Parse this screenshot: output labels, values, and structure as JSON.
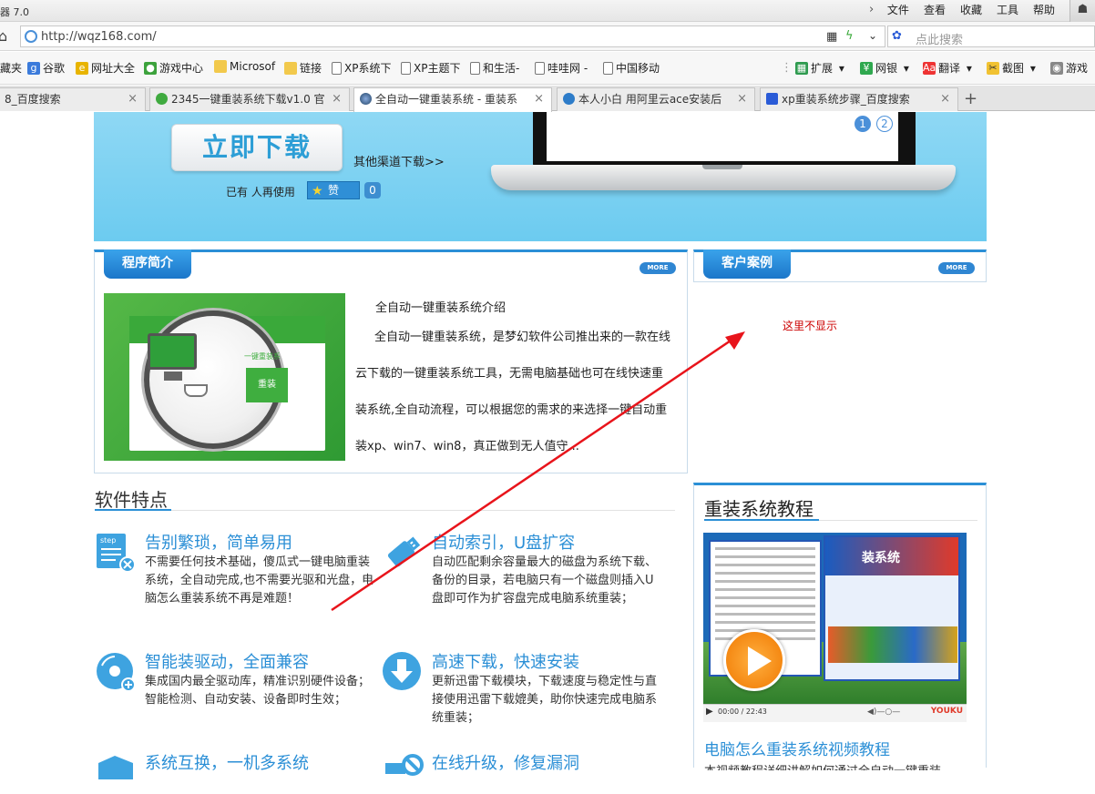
{
  "browser": {
    "app_title": "器 7.0",
    "menu": [
      "文件",
      "查看",
      "收藏",
      "工具",
      "帮助"
    ],
    "url": "http://wqz168.com/",
    "search_placeholder": "点此搜索",
    "favorites": [
      {
        "label": "藏夹",
        "icon": "none"
      },
      {
        "label": "谷歌",
        "icon": "google-icon"
      },
      {
        "label": "网址大全",
        "icon": "globe-icon"
      },
      {
        "label": "游戏中心",
        "icon": "game-icon"
      },
      {
        "label": "Microsof",
        "icon": "folder-icon"
      },
      {
        "label": "链接",
        "icon": "folder-icon"
      },
      {
        "label": "XP系统下",
        "icon": "doc-icon"
      },
      {
        "label": "XP主题下",
        "icon": "doc-icon"
      },
      {
        "label": "和生活-",
        "icon": "doc-icon"
      },
      {
        "label": "哇哇网 -",
        "icon": "doc-icon"
      },
      {
        "label": "中国移动",
        "icon": "doc-icon"
      }
    ],
    "tools": [
      {
        "label": "扩展",
        "icon": "extension-icon"
      },
      {
        "label": "网银",
        "icon": "bank-icon"
      },
      {
        "label": "翻译",
        "icon": "translate-icon"
      },
      {
        "label": "截图",
        "icon": "screenshot-icon"
      },
      {
        "label": "游戏",
        "icon": "game-icon"
      }
    ],
    "tabs": [
      {
        "label": "8_百度搜索",
        "active": false
      },
      {
        "label": "2345一键重装系统下载v1.0 官",
        "active": false
      },
      {
        "label": "全自动一键重装系统 - 重装系",
        "active": true
      },
      {
        "label": "本人小白 用阿里云ace安装后",
        "active": false
      },
      {
        "label": "xp重装系统步骤_百度搜索",
        "active": false
      }
    ]
  },
  "banner": {
    "download_label": "立即下载",
    "other_download": "其他渠道下载>>",
    "users_text": "已有 人再使用",
    "like_label": "赞",
    "like_count": "0",
    "slide_dots": [
      "1",
      "2"
    ]
  },
  "intro": {
    "tab_label": "程序简介",
    "more_label": "MORE",
    "image_text": "一键重装系",
    "image_button": "重装",
    "title": "全自动一键重装系统介绍",
    "text": "全自动一键重装系统，是梦幻软件公司推出来的一款在线云下载的一键重装系统工具，无需电脑基础也可在线快速重装系统,全自动流程，可以根据您的需求的来选择一键自动重装xp、win7、win8，真正做到无人值守..."
  },
  "cases": {
    "tab_label": "客户案例",
    "more_label": "MORE",
    "annotation": "这里不显示"
  },
  "features": {
    "title": "软件特点",
    "items": [
      {
        "title": "告别繁琐，简单易用",
        "desc": "不需要任何技术基础，傻瓜式一键电脑重装系统，全自动完成,也不需要光驱和光盘，电脑怎么重装系统不再是难题！",
        "icon": "step-icon"
      },
      {
        "title": "自动索引，U盘扩容",
        "desc": "自动匹配剩余容量最大的磁盘为系统下载、备份的目录，若电脑只有一个磁盘则插入U盘即可作为扩容盘完成电脑系统重装；",
        "icon": "usb-icon"
      },
      {
        "title": "智能装驱动，全面兼容",
        "desc": "集成国内最全驱动库，精准识别硬件设备；智能检测、自动安装、设备即时生效；",
        "icon": "disc-icon"
      },
      {
        "title": "高速下载，快速安装",
        "desc": "更新迅雷下载模块，下载速度与稳定性与直接使用迅雷下载媲美，助你快速完成电脑系统重装；",
        "icon": "download-icon"
      },
      {
        "title": "系统互换，一机多系统",
        "desc": "",
        "icon": "shield-icon"
      },
      {
        "title": "在线升级，修复漏洞",
        "desc": "",
        "icon": "no-sign-icon"
      }
    ]
  },
  "tutorial": {
    "title": "重装系统教程",
    "video_banner": "装系统",
    "video_time": "00:00 / 22:43",
    "video_brand": "YOUKU",
    "video_title": "电脑怎么重装系统视频教程",
    "video_desc": "本视频教程详细讲解如何通过全自动一键重装"
  },
  "colors": {
    "accent": "#2b8fd6",
    "annotation_arrow": "#e8141b"
  }
}
